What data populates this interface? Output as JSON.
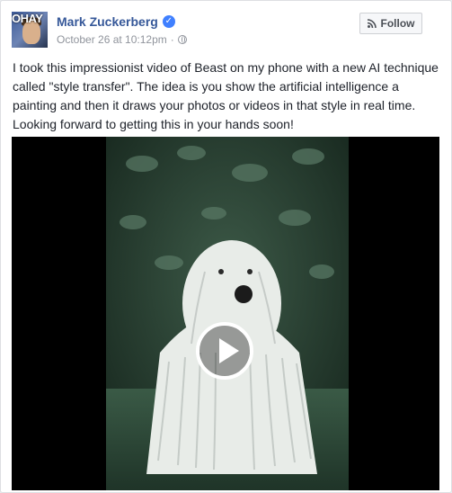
{
  "post": {
    "author_name": "Mark Zuckerberg",
    "timestamp": "October 26 at 10:12pm",
    "separator": "·",
    "avatar_watermark": "OHAY",
    "follow_label": "Follow",
    "text": "I took this impressionist video of Beast on my phone with a new AI technique called \"style transfer\". The idea is you show the artificial intelligence a painting and then it draws your photos or videos in that style in real time. Looking forward to getting this in your hands soon!",
    "verified_glyph": "✓"
  },
  "icons": {
    "verified": "verified-badge-icon",
    "privacy": "globe-icon",
    "follow": "rss-icon",
    "play": "play-icon"
  },
  "colors": {
    "author_link": "#365899",
    "verified_badge": "#4080ff",
    "meta_text": "#90949c",
    "video_background": "#000000"
  }
}
